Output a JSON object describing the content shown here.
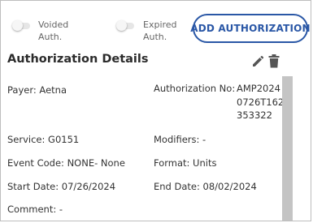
{
  "toggles": {
    "voided": {
      "label": "Voided Auth."
    },
    "expired": {
      "label": "Expired Auth."
    }
  },
  "actions": {
    "add_authorization": "ADD AUTHORIZATION"
  },
  "panel": {
    "title": "Authorization Details",
    "payer": "Payer: Aetna",
    "authorization_no_label": "Authorization No:",
    "authorization_no_value": "AMP20240726T162353322",
    "service": "Service: G0151",
    "modifiers": "Modifiers: -",
    "event_code": "Event Code: NONE- None",
    "format": "Format: Units",
    "start_date": "Start Date: 07/26/2024",
    "end_date": "End Date: 08/02/2024",
    "comment": "Comment: -"
  },
  "icons": {
    "edit": "pencil-icon",
    "delete": "trash-icon"
  },
  "colors": {
    "accent": "#2a57a6",
    "icon": "#555555",
    "scrollbar": "#c4c4c4"
  }
}
